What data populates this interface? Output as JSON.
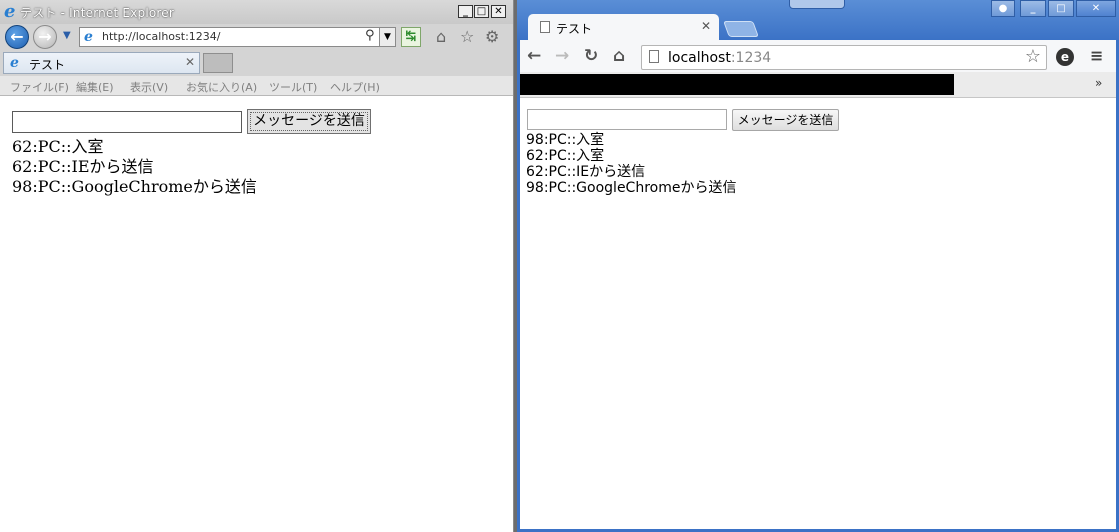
{
  "ie": {
    "window_title": "テスト - Internet Explorer",
    "address": "http://localhost:1234/",
    "tab_label": "テスト",
    "menu": [
      "ファイル(F)",
      "編集(E)",
      "表示(V)",
      "お気に入り(A)",
      "ツール(T)",
      "ヘルプ(H)"
    ],
    "send_label": "メッセージを送信",
    "input_value": "",
    "messages": [
      "62:PC::入室",
      "62:PC::IEから送信",
      "98:PC::GoogleChromeから送信"
    ]
  },
  "chrome": {
    "tab_label": "テスト",
    "url_host": "localhost",
    "url_port": ":1234",
    "bookmarks_more": "»",
    "send_label": "メッセージを送信",
    "input_value": "",
    "messages": [
      "98:PC::入室",
      "62:PC::入室",
      "62:PC::IEから送信",
      "98:PC::GoogleChromeから送信"
    ]
  },
  "colors": {
    "chrome_frame": "#3b72c6",
    "ie_frame": "#d4d4d4"
  }
}
